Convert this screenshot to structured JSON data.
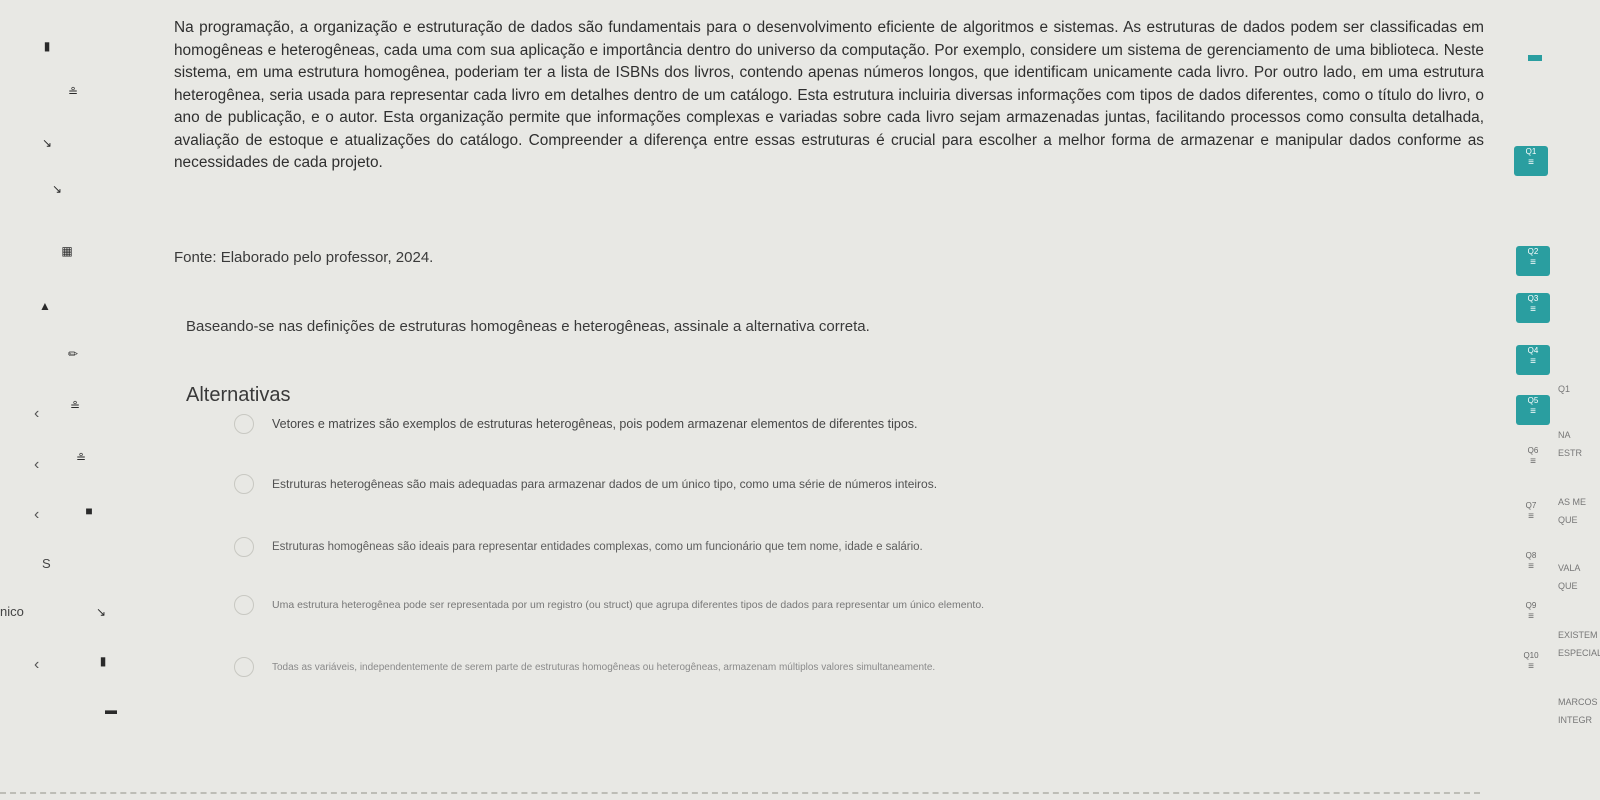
{
  "sidebar": {
    "fragment_left": "nico",
    "dollar": "S"
  },
  "content": {
    "paragraph": "Na programação, a organização e estruturação de dados são fundamentais para o desenvolvimento eficiente de algoritmos e sistemas. As estruturas de dados podem ser classificadas em homogêneas e heterogêneas, cada uma com sua aplicação e importância dentro do universo da computação. Por exemplo, considere um sistema de gerenciamento de uma biblioteca. Neste sistema, em uma estrutura homogênea, poderiam ter a lista de ISBNs dos livros, contendo apenas números longos, que identificam unicamente cada livro. Por outro lado, em uma estrutura heterogênea, seria usada para representar cada livro em detalhes dentro de um catálogo. Esta estrutura incluiria diversas informações com tipos de dados diferentes, como o título do livro, o ano de publicação, e o autor. Esta organização permite que informações complexas e variadas sobre cada livro sejam armazenadas juntas, facilitando processos como consulta detalhada, avaliação de estoque e atualizações do catálogo. Compreender a diferença entre essas estruturas é crucial para escolher a melhor forma de armazenar e manipular dados conforme as necessidades de cada projeto.",
    "source": "Fonte: Elaborado pelo professor, 2024.",
    "question": "Baseando-se nas definições de estruturas homogêneas e heterogêneas, assinale a alternativa correta.",
    "alternatives_title": "Alternativas",
    "options": [
      "Vetores e matrizes são exemplos de estruturas heterogêneas, pois podem armazenar elementos de diferentes tipos.",
      "Estruturas heterogêneas são mais adequadas para armazenar dados de um único tipo, como uma série de números inteiros.",
      "Estruturas homogêneas são ideais para representar entidades complexas, como um funcionário que tem nome, idade e salário.",
      "Uma estrutura heterogênea pode ser representada por um registro (ou struct) que agrupa diferentes tipos de dados para representar um único elemento.",
      "Todas as variáveis, independentemente de serem parte de estruturas homogêneas ou heterogêneas, armazenam múltiplos valores simultaneamente."
    ]
  },
  "navigator": {
    "items": [
      {
        "label": "Q1"
      },
      {
        "label": "Q2"
      },
      {
        "label": "Q3"
      },
      {
        "label": "Q4"
      },
      {
        "label": "Q5"
      },
      {
        "label": "Q6"
      },
      {
        "label": "Q7"
      },
      {
        "label": "Q8"
      },
      {
        "label": "Q9"
      },
      {
        "label": "Q10"
      }
    ],
    "side_texts": [
      "Q1",
      "NA",
      "ESTR",
      "AS ME",
      "QUE",
      "VALA",
      "QUE",
      "EXISTEM",
      "ESPECIAL",
      "MARCOS",
      "INTEGR"
    ],
    "accent": "#2a9ea0"
  }
}
